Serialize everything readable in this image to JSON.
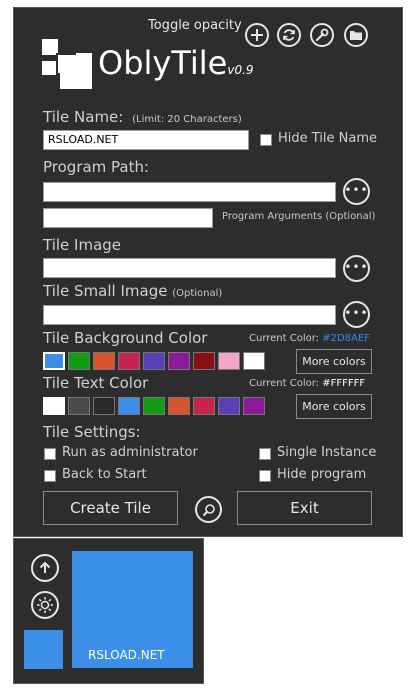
{
  "header": {
    "toggle_opacity": "Toggle opacity",
    "app_name": "OblyTile",
    "version": "v0.9"
  },
  "tile_name": {
    "label": "Tile Name:",
    "limit": "(Limit: 20 Characters)",
    "value": "RSLOAD.NET",
    "hide_label": "Hide Tile Name"
  },
  "program_path": {
    "label": "Program Path:",
    "value": "",
    "arguments_value": "",
    "arguments_label": "Program Arguments (Optional)"
  },
  "tile_image": {
    "label": "Tile Image",
    "value": ""
  },
  "tile_small_image": {
    "label": "Tile Small Image",
    "optional": "(Optional)",
    "value": ""
  },
  "background_color": {
    "label": "Tile Background Color",
    "current_prefix": "Current Color:",
    "current_value": "#2D8AEF",
    "current_value_color": "#2d8aef",
    "swatches": [
      "#3b8fe8",
      "#119c11",
      "#d9532c",
      "#c6244e",
      "#5a3fb8",
      "#8c1b9a",
      "#8b0f12",
      "#f5a5c8",
      "#ffffff"
    ],
    "more_label": "More colors"
  },
  "text_color": {
    "label": "Tile Text Color",
    "current_prefix": "Current Color:",
    "current_value": "#FFFFFF",
    "swatches": [
      "#ffffff",
      "#4a4a4a",
      "#2a2a2a",
      "#3b8fe8",
      "#119c11",
      "#d9532c",
      "#c6244e",
      "#5a3fb8",
      "#8c1b9a"
    ],
    "more_label": "More colors"
  },
  "settings": {
    "label": "Tile Settings:",
    "run_as_admin": "Run as administrator",
    "back_to_start": "Back to Start",
    "single_instance": "Single Instance",
    "hide_program": "Hide program"
  },
  "actions": {
    "create": "Create Tile",
    "exit": "Exit"
  },
  "preview": {
    "tile_text": "RSLOAD.NET",
    "tile_color": "#3b8fe8"
  }
}
